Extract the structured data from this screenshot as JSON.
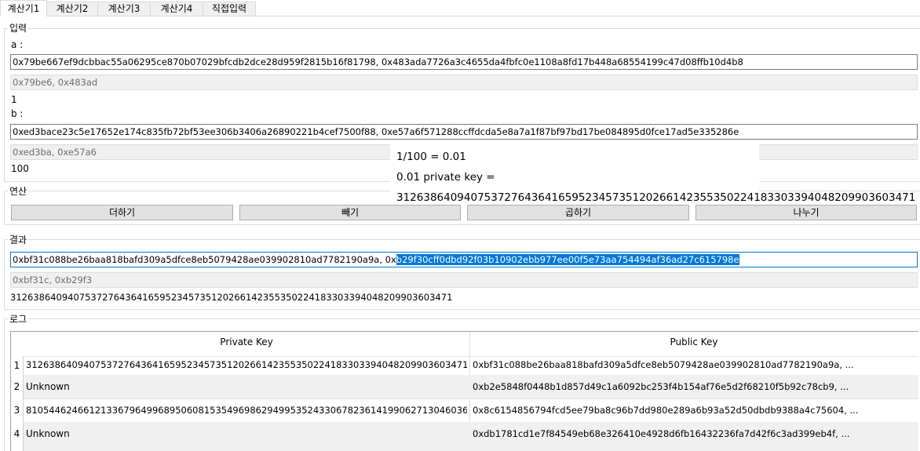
{
  "tabs": [
    "계산기1",
    "계산기2",
    "계산기3",
    "계산기4",
    "직접입력"
  ],
  "input_group": {
    "title": "입력",
    "a_label": "a :",
    "a_value": "0x79be667ef9dcbbac55a06295ce870b07029bfcdb2dce28d959f2815b16f81798, 0x483ada7726a3c4655da4fbfc0e1108a8fd17b448a68554199c47d08ffb10d4b8",
    "a_short": "0x79be6, 0x483ad",
    "a_scalar": "1",
    "b_label": "b :",
    "b_value": "0xed3bace23c5e17652e174c835fb72bf53ee306b3406a26890221b4cef7500f88, 0xe57a6f571288ccffdcda5e8a7a1f87bf97bd17be084895d0fce17ad5e335286e",
    "b_short": "0xed3ba, 0xe57a6",
    "b_scalar": "100"
  },
  "tooltip": {
    "line1": "1/100 = 0.01",
    "line2": "0.01 private key =",
    "line3": "31263864094075372764364165952345735120266142355350224183303394048209903603471"
  },
  "ops_group": {
    "title": "연산",
    "add": "더하기",
    "sub": "빼기",
    "mul": "곱하기",
    "div": "나누기"
  },
  "result_group": {
    "title": "결과",
    "value_plain": "0xbf31c088be26baa818bafd309a5dfce8eb5079428ae039902810ad7782190a9a, 0x",
    "value_selected": "b29f30cff0dbd92f03b10902ebb977ee00f5e73aa754494af36ad27c615798e",
    "short": "0xbf31c, 0xb29f3",
    "scalar": "31263864094075372764364165952345735120266142355350224183303394048209903603471"
  },
  "log_group": {
    "title": "로그",
    "columns": [
      "Private Key",
      "Public Key"
    ],
    "rows": [
      {
        "n": "1",
        "private": "31263864094075372764364165952345735120266142355350224183303394048209903603471",
        "public": "0xbf31c088be26baa818bafd309a5dfce8eb5079428ae039902810ad7782190a9a, ..."
      },
      {
        "n": "2",
        "private": "Unknown",
        "public": "0xb2e5848f0448b1d857d49c1a6092bc253f4b154af76e5d2f68210f5b92c78cb9, ..."
      },
      {
        "n": "3",
        "private": "81054462466121336796499689506081535496986294995352433067823614199062713046036",
        "public": "0x8c6154856794fcd5ee79ba8c96b7dd980e289a6b93a52d50dbdb9388a4c75604, ..."
      },
      {
        "n": "4",
        "private": "Unknown",
        "public": "0xdb1781cd1e7f84549eb68e326410e4928d6fb16432236fa7d42f6c3ad399eb4f, ..."
      }
    ]
  },
  "colors": {
    "selection": "#0078d7",
    "focus_border": "#0078d7",
    "button_bg": "#e1e1e1"
  }
}
